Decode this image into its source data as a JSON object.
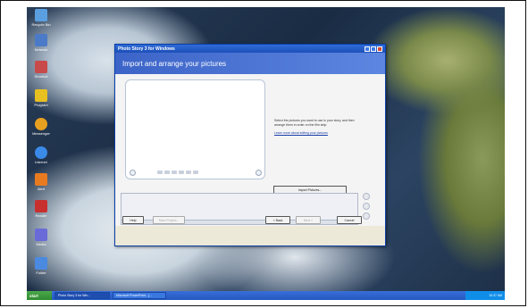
{
  "desktop": {
    "icons": [
      {
        "name": "recycle-bin-icon",
        "label": "Recycle Bin",
        "color": "#5aa0e0"
      },
      {
        "name": "network-icon",
        "label": "Network",
        "color": "#4a7ac8"
      },
      {
        "name": "shortcut-icon",
        "label": "Shortcut",
        "color": "#c84a4a"
      },
      {
        "name": "app-icon",
        "label": "Program",
        "color": "#e8c020"
      },
      {
        "name": "messenger-icon",
        "label": "Messenger",
        "color": "#e8a020"
      },
      {
        "name": "ie-icon",
        "label": "Internet",
        "color": "#3a8ae8"
      },
      {
        "name": "warning-icon",
        "label": "Alert",
        "color": "#e87a20"
      },
      {
        "name": "pdf-icon",
        "label": "Reader",
        "color": "#c83030"
      },
      {
        "name": "media-icon",
        "label": "Media",
        "color": "#6a6ad8"
      },
      {
        "name": "folder-icon",
        "label": "Folder",
        "color": "#4a8ae0"
      }
    ]
  },
  "window": {
    "title": "Photo Story 3 for Windows",
    "banner_title": "Import and arrange your pictures",
    "help_text": "Select the pictures you want to use in your story, and then arrange them in order on the film strip.",
    "help_link": "Learn more about editing your pictures",
    "import_button": "Import Pictures...",
    "buttons": {
      "help": "Help",
      "save_project": "Save Project...",
      "back": "< Back",
      "next": "Next >",
      "cancel": "Cancel"
    }
  },
  "taskbar": {
    "start": "start",
    "tasks": [
      "Photo Story 3 for Win...",
      "Microsoft PowerPoint - [..."
    ],
    "clock": "10:37 AM"
  }
}
